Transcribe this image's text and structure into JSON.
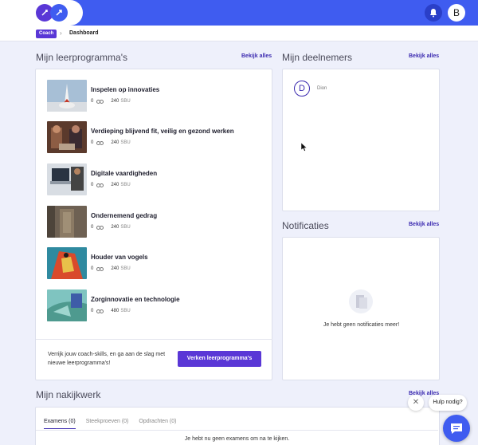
{
  "header": {
    "avatar_initial": "B",
    "colors": {
      "primary": "#3f5cf0",
      "accent": "#5a37d6"
    }
  },
  "breadcrumb": {
    "badge": "Coach",
    "current": "Dashboard"
  },
  "programmes": {
    "title": "Mijn leerprogramma's",
    "see_all": "Bekijk alles",
    "items": [
      {
        "title": "Inspelen op innovaties",
        "count": "0",
        "sbu_value": "240",
        "sbu_unit": "SBU"
      },
      {
        "title": "Verdieping blijvend fit, veilig en gezond werken",
        "count": "0",
        "sbu_value": "240",
        "sbu_unit": "SBU"
      },
      {
        "title": "Digitale vaardigheden",
        "count": "0",
        "sbu_value": "240",
        "sbu_unit": "SBU"
      },
      {
        "title": "Ondernemend gedrag",
        "count": "0",
        "sbu_value": "240",
        "sbu_unit": "SBU"
      },
      {
        "title": "Houder van vogels",
        "count": "0",
        "sbu_value": "240",
        "sbu_unit": "SBU"
      },
      {
        "title": "Zorginnovatie en technologie",
        "count": "0",
        "sbu_value": "480",
        "sbu_unit": "SBU"
      }
    ],
    "promo_text": "Verrijk jouw coach-skills, en ga aan de slag met nieuwe leerprogramma's!",
    "promo_button": "Verken leerprogramma's"
  },
  "participants": {
    "title": "Mijn deelnemers",
    "see_all": "Bekijk alles",
    "items": [
      {
        "initial": "D",
        "name": "Dion"
      }
    ]
  },
  "notifications": {
    "title": "Notificaties",
    "see_all": "Bekijk alles",
    "empty": "Je hebt geen notificaties meer!"
  },
  "review": {
    "title": "Mijn nakijkwerk",
    "see_all": "Bekijk alles",
    "tabs": [
      "Examens (0)",
      "Steekproeven (0)",
      "Opdrachten (0)"
    ],
    "empty": "Je hebt nu geen examens om na te kijken."
  },
  "help": {
    "label": "Hulp nodig?",
    "close": "✕"
  }
}
